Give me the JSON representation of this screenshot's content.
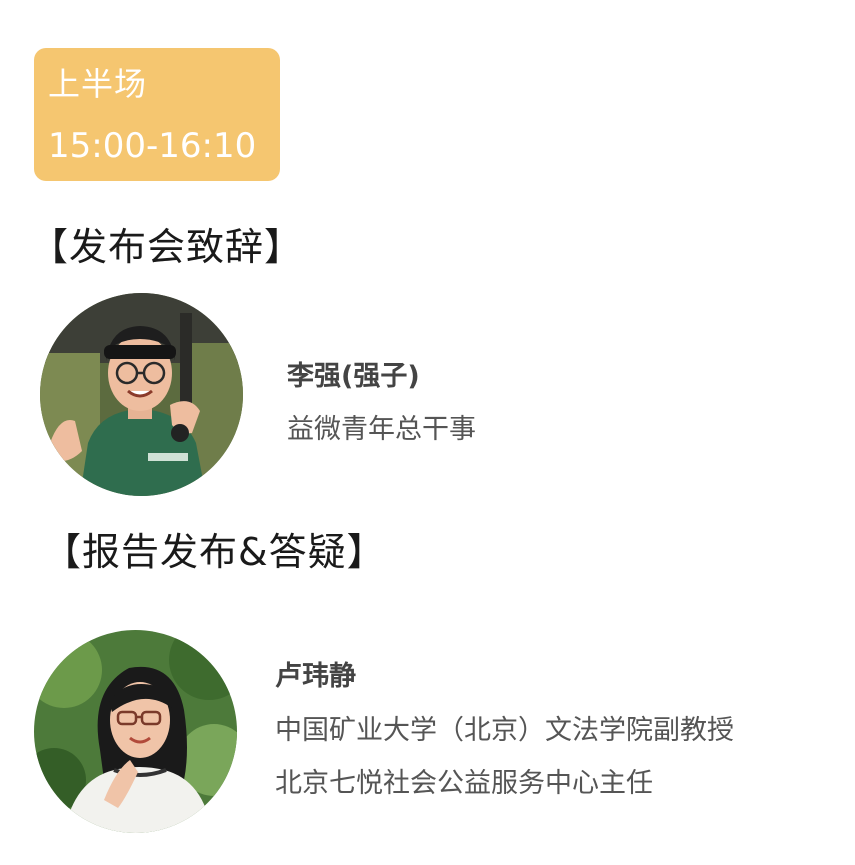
{
  "colors": {
    "badge_background": "#f5c670",
    "badge_text": "#ffffff",
    "heading_text": "#1a1a1a",
    "name_text": "#444444",
    "title_text": "#555555"
  },
  "schedule_badge": {
    "session": "上半场",
    "time": "15:00-16:10"
  },
  "sections": [
    {
      "heading": "【发布会致辞】",
      "speaker": {
        "name": "李强(强子)",
        "titles": [
          "益微青年总干事"
        ],
        "avatar": "person-photo-man-green-hoodie"
      }
    },
    {
      "heading": "【报告发布&答疑】",
      "speaker": {
        "name": "卢玮静",
        "titles": [
          "中国矿业大学（北京）文法学院副教授",
          "北京七悦社会公益服务中心主任"
        ],
        "avatar": "person-photo-woman-glasses"
      }
    }
  ]
}
